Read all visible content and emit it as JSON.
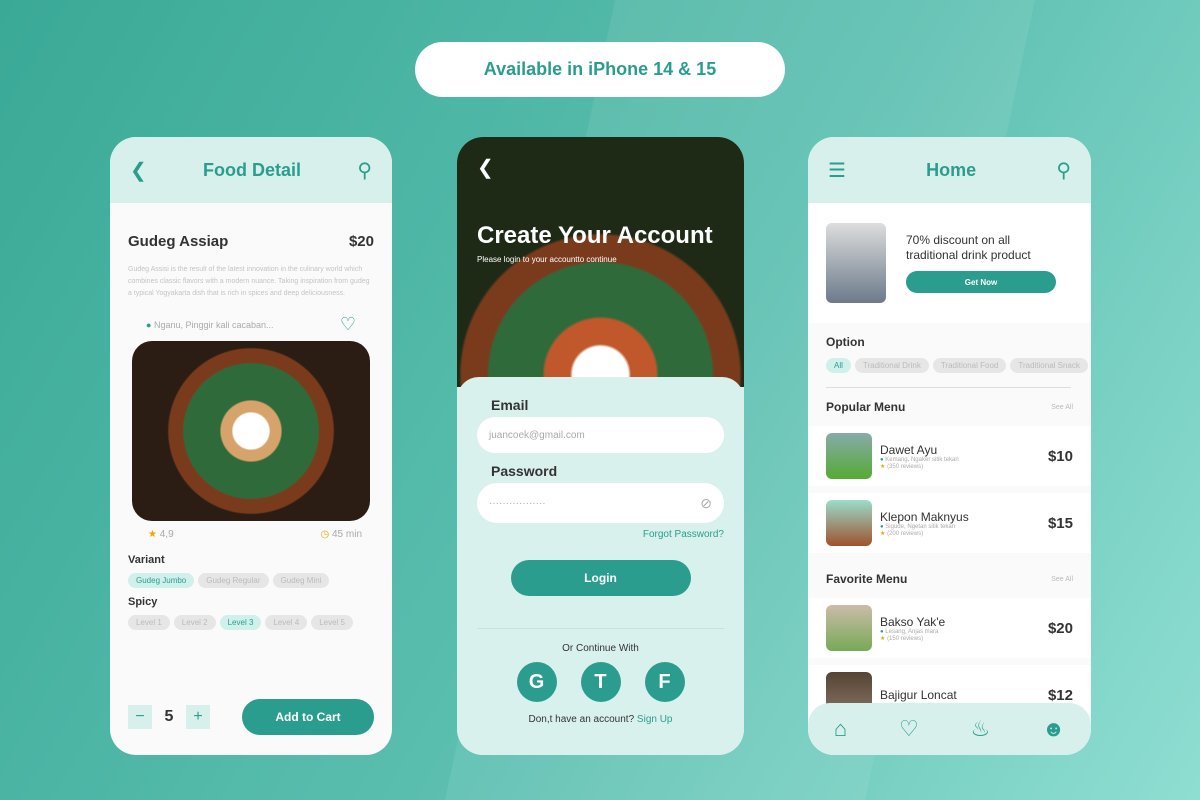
{
  "banner": "Available in iPhone 14 & 15",
  "colors": {
    "accent": "#2a9d8f",
    "mint": "#d7f0ec",
    "star": "#f0a500"
  },
  "detail": {
    "title": "Food Detail",
    "name": "Gudeg Assiap",
    "price": "$20",
    "description": "Gudeg Assisi is the result of the latest innovation in the culinary world which combines classic flavors with a modern nuance. Taking inspiration from gudeg a typical Yogyakarta dish that is rich in spices and deep deliciousness.",
    "location": "Nganu, Pinggir kali cacaban...",
    "rating": "4,9",
    "time": "45 min",
    "variant_label": "Variant",
    "variants": [
      "Gudeg Jumbo",
      "Gudeg Regular",
      "Gudeg Mini"
    ],
    "spicy_label": "Spicy",
    "levels": [
      "Level 1",
      "Level 2",
      "Level 3",
      "Level 4",
      "Level 5"
    ],
    "quantity": "5",
    "minus": "−",
    "plus": "+",
    "add_to_cart": "Add to Cart"
  },
  "login": {
    "title": "Create Your Account",
    "subtitle": "Please login to your accountto continue",
    "email_label": "Email",
    "email_value": "juancoek@gmail.com",
    "password_label": "Password",
    "password_value": "·················",
    "forgot": "Forgot Password?",
    "login": "Login",
    "or": "Or Continue With",
    "socials": [
      "G",
      "T",
      "F"
    ],
    "no_account": "Don,t have an account?",
    "signup": "Sign Up"
  },
  "home": {
    "title": "Home",
    "promo": "70% discount on all traditional drink product",
    "get_now": "Get Now",
    "option_label": "Option",
    "options": [
      "All",
      "Traditional Drink",
      "Traditional Food",
      "Traditional Snack"
    ],
    "popular_label": "Popular Menu",
    "see_all": "See All",
    "favorite_label": "Favorite Menu",
    "popular": [
      {
        "name": "Dawet Ayu",
        "loc": "Kemang, Ngaker sitik tekan",
        "reviews": "(350 reviews)",
        "price": "$10"
      },
      {
        "name": "Klepon Maknyus",
        "loc": "Sigude, Ngetan sitik tekan",
        "reviews": "(200 reviews)",
        "price": "$15"
      }
    ],
    "favorite": [
      {
        "name": "Bakso Yak'e",
        "loc": "Lesang, Anjas mara",
        "reviews": "(150 reviews)",
        "price": "$20"
      },
      {
        "name": "Bajigur Loncat",
        "loc": "",
        "reviews": "",
        "price": "$12"
      }
    ]
  }
}
